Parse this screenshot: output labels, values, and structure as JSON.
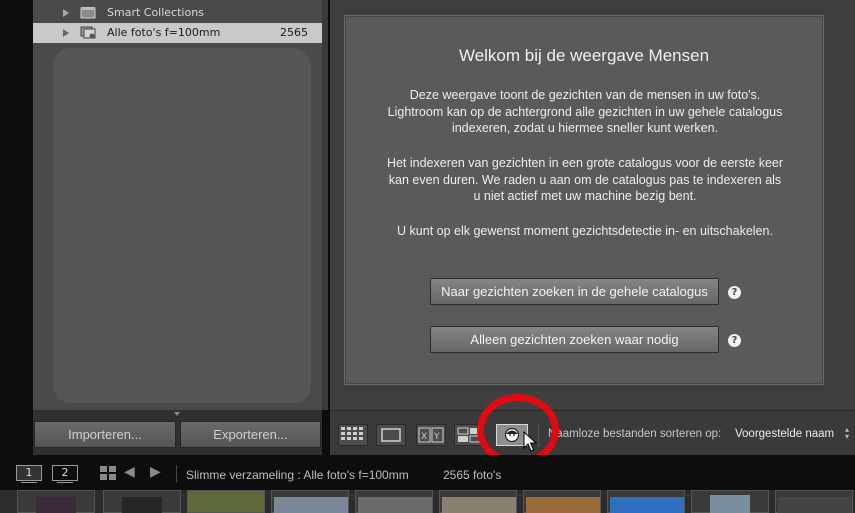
{
  "collections": [
    {
      "label": "Smart Collections",
      "count": ""
    },
    {
      "label": "Alle foto's f=100mm",
      "count": "2565"
    }
  ],
  "dialog": {
    "title": "Welkom bij de weergave Mensen",
    "para1": "Deze weergave toont de gezichten van de mensen in uw foto's. Lightroom kan op de achtergrond alle gezichten in uw gehele catalogus indexeren, zodat u hiermee sneller kunt werken.",
    "para2": "Het indexeren van gezichten in een grote catalogus voor de eerste keer kan even duren. We raden u aan om de catalogus pas te indexeren als u niet actief met uw machine bezig bent.",
    "para3": "U kunt op elk gewenst moment gezichtsdetectie in- en uitschakelen.",
    "btn_full": "Naar gezichten zoeken in de gehele catalogus",
    "btn_needed": "Alleen gezichten zoeken waar nodig",
    "help_glyph": "?"
  },
  "left_buttons": {
    "import": "Importeren...",
    "export": "Exporteren..."
  },
  "toolbar": {
    "sort_label": "Naamloze bestanden sorteren op:",
    "sort_value": "Voorgestelde naam",
    "sort_arrows": "▲▼",
    "compare_label": "X|Y"
  },
  "filmbar": {
    "monitor1": "1",
    "monitor2": "2",
    "back": "◀",
    "forward": "▶",
    "source": "Slimme verzameling : Alle foto's f=100mm",
    "count": "2565 foto's"
  },
  "colors": {
    "annotation_ring": "#e00b12",
    "selected_row": "#c9c9c9"
  },
  "icons": [
    "folder-icon",
    "smart-collection-icon",
    "grid-view-icon",
    "loupe-view-icon",
    "compare-view-icon",
    "survey-view-icon",
    "people-view-icon",
    "help-icon",
    "mouse-cursor-icon"
  ]
}
